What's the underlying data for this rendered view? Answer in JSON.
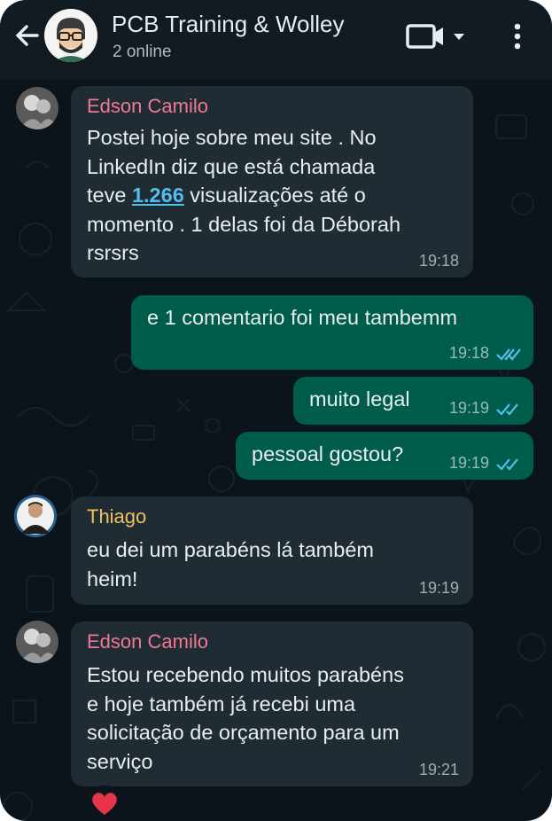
{
  "header": {
    "title": "PCB Training & Wolley",
    "subtitle": "2 online",
    "icons": [
      "back-arrow-icon",
      "group-avatar",
      "video-call-icon",
      "chevron-down-icon",
      "more-vert-icon"
    ]
  },
  "colors": {
    "background": "#0b141a",
    "incoming_bubble": "#202c33",
    "outgoing_bubble": "#005c4b",
    "sender_pink": "#f07896",
    "sender_yellow": "#f0c060",
    "read_ticks": "#53bdeb"
  },
  "messages": [
    {
      "sender": "Edson Camilo",
      "lines": [
        "Postei hoje sobre meu site . No",
        "LinkedIn diz que está chamada"
      ],
      "line3_before": "teve ",
      "link": "1.266",
      "line3_after": " visualizações até o",
      "lines_after": [
        "momento . 1 delas foi da Déborah",
        "rsrsrs"
      ],
      "time": "19:18"
    },
    {
      "text": "e 1 comentario foi meu tambemm",
      "time": "19:18"
    },
    {
      "text": "muito legal",
      "time": "19:19"
    },
    {
      "text": "pessoal gostou?",
      "time": "19:19"
    },
    {
      "sender": "Thiago",
      "lines": [
        "eu dei um parabéns lá também",
        "heim!"
      ],
      "time": "19:19"
    },
    {
      "sender": "Edson Camilo",
      "lines": [
        "Estou recebendo muitos parabéns",
        "e hoje também já recebi uma",
        "solicitação de orçamento para um",
        "serviço"
      ],
      "time": "19:21",
      "reaction": "❤️"
    }
  ]
}
